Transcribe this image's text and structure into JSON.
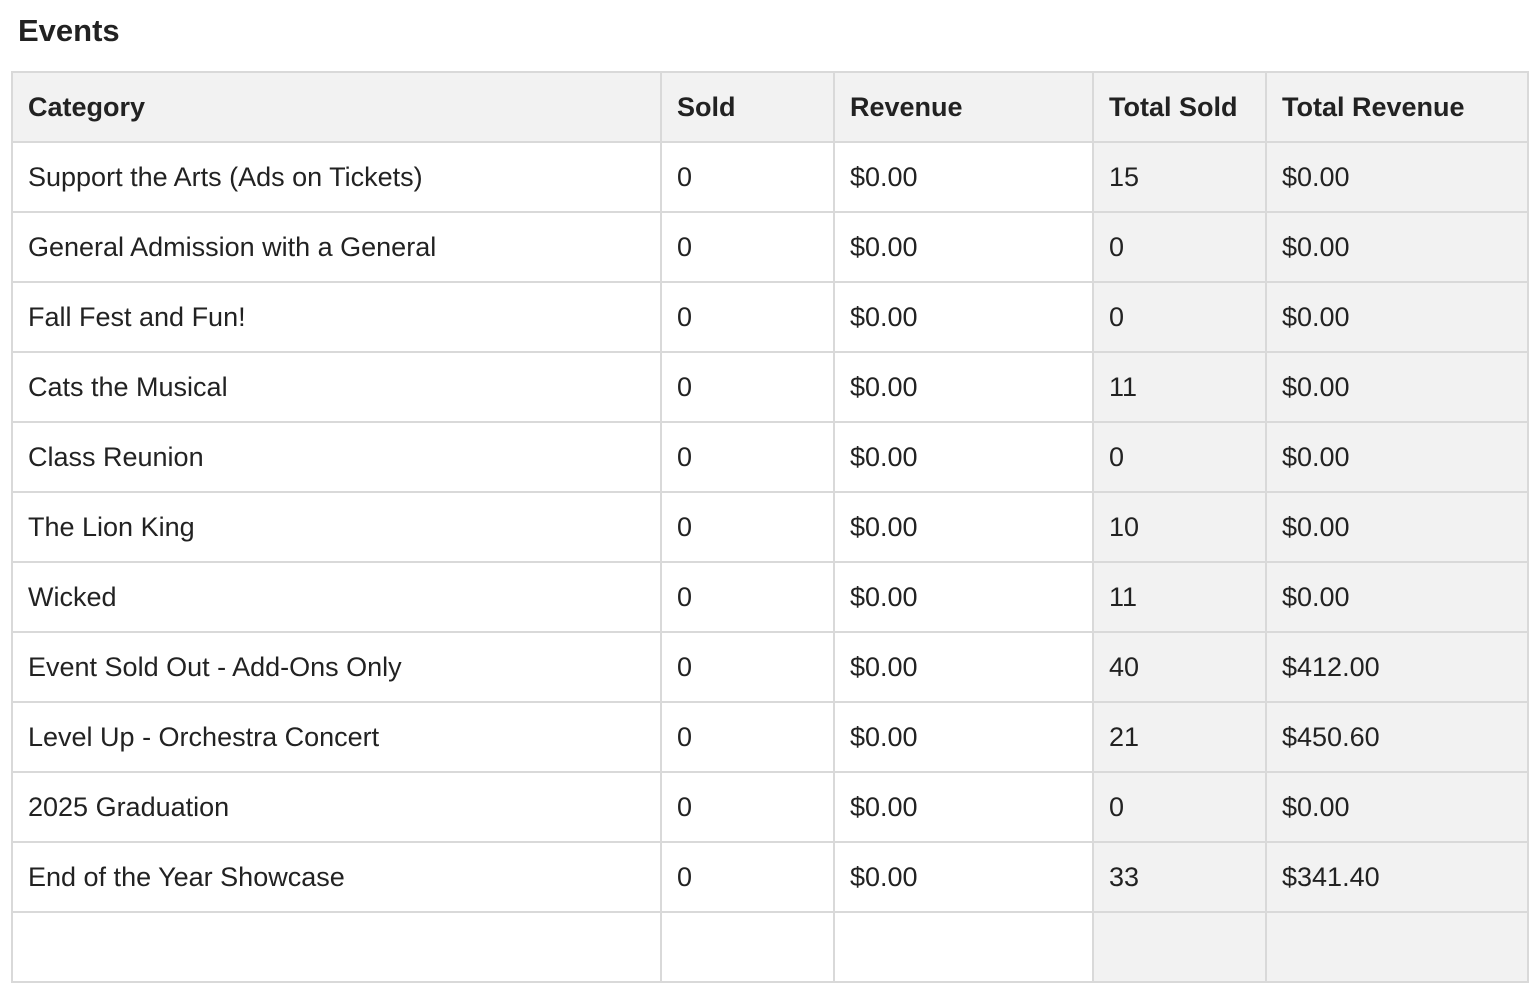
{
  "page": {
    "title": "Events"
  },
  "table": {
    "columns": [
      "Category",
      "Sold",
      "Revenue",
      "Total Sold",
      "Total Revenue"
    ],
    "rows": [
      {
        "category": "Support the Arts (Ads on Tickets)",
        "sold": "0",
        "revenue": "$0.00",
        "total_sold": "15",
        "total_revenue": "$0.00"
      },
      {
        "category": "General Admission with a General",
        "sold": "0",
        "revenue": "$0.00",
        "total_sold": "0",
        "total_revenue": "$0.00"
      },
      {
        "category": "Fall Fest and Fun!",
        "sold": "0",
        "revenue": "$0.00",
        "total_sold": "0",
        "total_revenue": "$0.00"
      },
      {
        "category": "Cats the Musical",
        "sold": "0",
        "revenue": "$0.00",
        "total_sold": "11",
        "total_revenue": "$0.00"
      },
      {
        "category": "Class Reunion",
        "sold": "0",
        "revenue": "$0.00",
        "total_sold": "0",
        "total_revenue": "$0.00"
      },
      {
        "category": "The Lion King",
        "sold": "0",
        "revenue": "$0.00",
        "total_sold": "10",
        "total_revenue": "$0.00"
      },
      {
        "category": "Wicked",
        "sold": "0",
        "revenue": "$0.00",
        "total_sold": "11",
        "total_revenue": "$0.00"
      },
      {
        "category": "Event Sold Out - Add-Ons Only",
        "sold": "0",
        "revenue": "$0.00",
        "total_sold": "40",
        "total_revenue": "$412.00"
      },
      {
        "category": "Level Up - Orchestra Concert",
        "sold": "0",
        "revenue": "$0.00",
        "total_sold": "21",
        "total_revenue": "$450.60"
      },
      {
        "category": "2025 Graduation",
        "sold": "0",
        "revenue": "$0.00",
        "total_sold": "0",
        "total_revenue": "$0.00"
      },
      {
        "category": "End of the Year Showcase",
        "sold": "0",
        "revenue": "$0.00",
        "total_sold": "33",
        "total_revenue": "$341.40"
      },
      {
        "category": "",
        "sold": "",
        "revenue": "",
        "total_sold": "",
        "total_revenue": ""
      }
    ]
  },
  "colors": {
    "header_bg": "#f2f2f2",
    "total_cols_bg": "#f2f2f2",
    "border": "#d9d9d9",
    "text": "#222222"
  }
}
